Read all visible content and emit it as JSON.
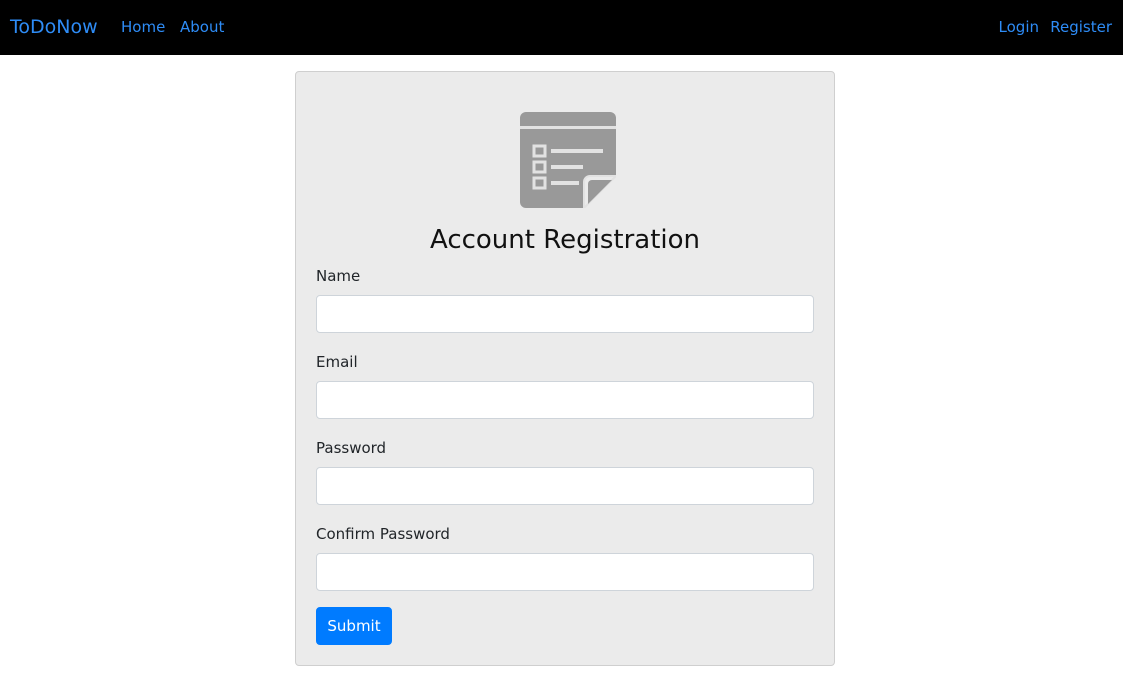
{
  "navbar": {
    "brand": "ToDoNow",
    "links": {
      "home": "Home",
      "about": "About",
      "login": "Login",
      "register": "Register"
    },
    "link_color": "#2e8cf6",
    "background": "#000000"
  },
  "form": {
    "icon": "todo-list-icon",
    "title": "Account Registration",
    "fields": {
      "name": {
        "label": "Name",
        "value": ""
      },
      "email": {
        "label": "Email",
        "value": ""
      },
      "password": {
        "label": "Password",
        "value": ""
      },
      "confirm_password": {
        "label": "Confirm Password",
        "value": ""
      }
    },
    "submit_label": "Submit",
    "accent_color": "#007bff"
  }
}
